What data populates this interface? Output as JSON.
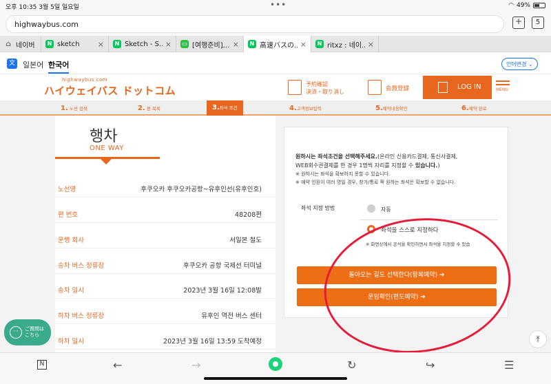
{
  "status_bar": {
    "time": "오후 10:35  3월 5일 일요일",
    "wifi_icon": "wifi-icon",
    "battery": "49%"
  },
  "address_bar": {
    "url": "highwaybus.com",
    "tab_count": "5",
    "new_tab": "+"
  },
  "tabs": [
    {
      "label": "네이버",
      "icon": "home-icon",
      "fav": "⌂"
    },
    {
      "label": "sketch",
      "fav": "N"
    },
    {
      "label": "Sketch - S...",
      "fav": "N"
    },
    {
      "label": "[여행준비]...",
      "fav": "▭"
    },
    {
      "label": "高速バスの...",
      "fav": "N"
    },
    {
      "label": "ritxz : 네이...",
      "fav": "N"
    }
  ],
  "tab_close": "×",
  "language": {
    "icon": "文",
    "japanese": "일본어",
    "korean": "한국어",
    "change": "언어변경 ⌄"
  },
  "header": {
    "logo_small": "highwaybus.com",
    "logo": "ハイウェイバス ドットコム",
    "reserve_line1": "予約確認",
    "reserve_line2": "決済・取り消し",
    "member": "会員登録",
    "login": "LOG IN",
    "menu": "MENU"
  },
  "steps": [
    {
      "num": "1.",
      "label": "노선 검색"
    },
    {
      "num": "2.",
      "label": "편 목록"
    },
    {
      "num": "3.",
      "label": "좌석 조건"
    },
    {
      "num": "4.",
      "label": "고객정보입력"
    },
    {
      "num": "5.",
      "label": "예약내용확인"
    },
    {
      "num": "6.",
      "label": "예약 완료"
    }
  ],
  "trip": {
    "title": "행차",
    "subtitle": "ONE WAY",
    "rows": [
      {
        "key": "노선명",
        "value": "후쿠오카 후쿠오카공항~유후인선(유후인호)"
      },
      {
        "key": "편 번호",
        "value": "48208편"
      },
      {
        "key": "운행 회사",
        "value": "서일본 철도"
      },
      {
        "key": "승차 버스 정류장",
        "value": "후쿠오카 공항 국제선 터미널"
      },
      {
        "key": "승차 일시",
        "value": "2023년 3월 16일 12:08발"
      },
      {
        "key": "하차 버스 정류장",
        "value": "유후인 역전 버스 센터"
      },
      {
        "key": "하차 일시",
        "value": "2023년 3월 16일 13:59 도착예정"
      }
    ]
  },
  "seat": {
    "note_bold": "원하시는 좌석조건을 선택해주세요.",
    "note_rest": "(온라인 신용카드결제, 통신사결제,",
    "note_line2": "WEB회수권결제를 한 경우 1명씩 자리를 지정할 수 ",
    "note_line2_bold": "있습니다.",
    "note_line2_end": ")",
    "bullet1": "※ 원하시는 좌석을 확보하지 못할 수 있습니다.",
    "bullet2": "※ 예약 인원이 여러 명일 경우, 창가/통로 쪽 원하는 좌석은 확보할 수 없습니다.",
    "method_label": "좌석 지정 방법",
    "option_auto": "자동",
    "option_self": "좌석을 스스로 지정하다",
    "hint": "※ 화면상에서 공석을 확인하면서 좌석을 지정할 수 있습",
    "btn_return": "돌아오는 길도 선택한다(왕복예약) ➔",
    "btn_fare": "운임확인(편도예약) ➔"
  },
  "chat": {
    "icon": "···",
    "line1": "ご質問は",
    "line2": "こちら"
  },
  "scroll_top": "⤒",
  "toolbar": {
    "n": "N",
    "back": "←",
    "forward": "→",
    "reload": "↻",
    "share": "↪",
    "menu": "☰"
  },
  "colors": {
    "accent": "#e8661d",
    "annotation": "#e41c3a",
    "chat": "#3aaa8c"
  }
}
